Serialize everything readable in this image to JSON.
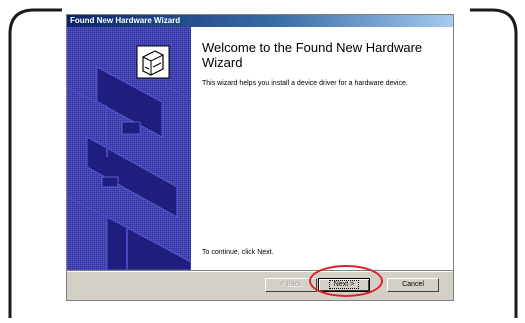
{
  "window": {
    "title": "Found New Hardware Wizard"
  },
  "content": {
    "heading": "Welcome to the Found New Hardware Wizard",
    "description": "This wizard helps you install a device driver for a hardware device.",
    "continue_text": "To continue, click Next."
  },
  "buttons": {
    "back_label": "< Back",
    "next_label": "Next >",
    "cancel_label": "Cancel"
  },
  "colors": {
    "sidebar": "#2f2fa8",
    "highlight": "#e0202a",
    "titlebar": "#0a246a"
  }
}
